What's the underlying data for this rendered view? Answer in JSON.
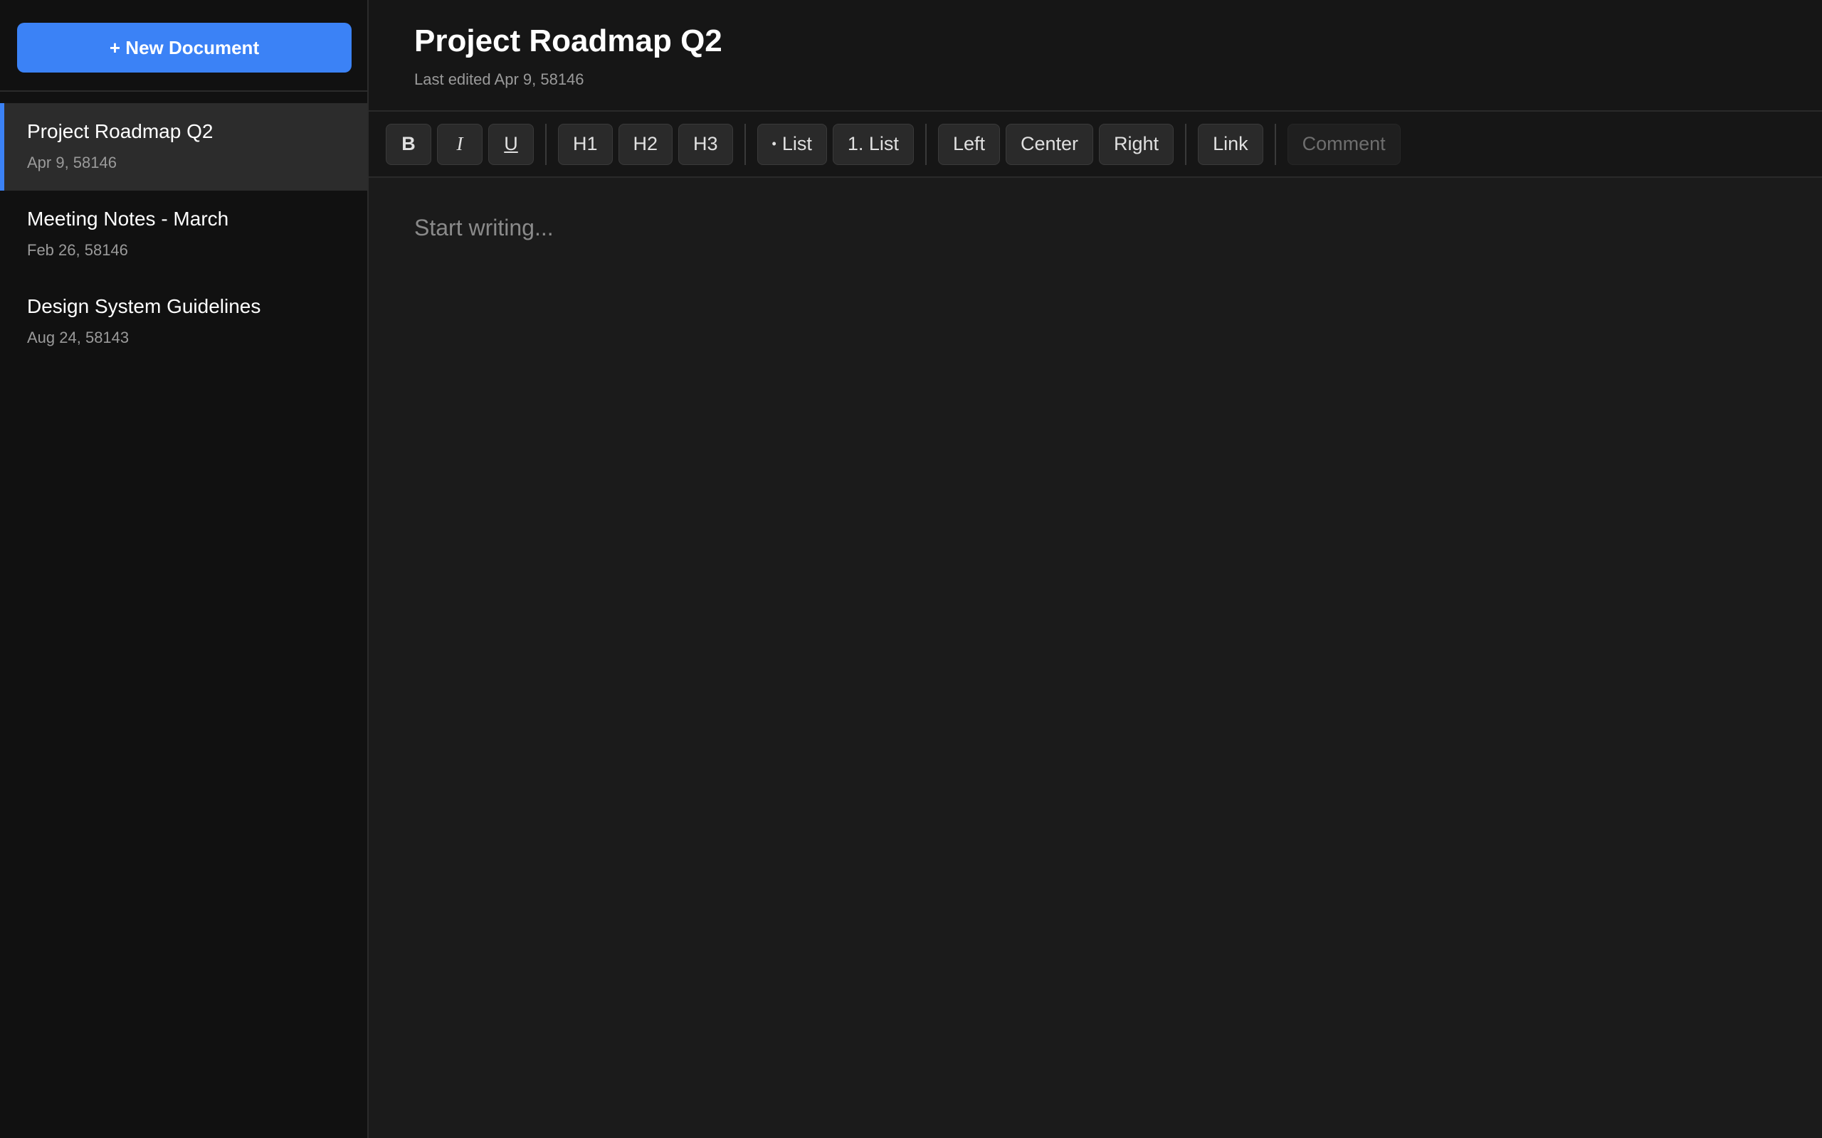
{
  "sidebar": {
    "new_document_label": "+ New Document",
    "documents": [
      {
        "title": "Project Roadmap Q2",
        "date": "Apr 9, 58146",
        "active": true
      },
      {
        "title": "Meeting Notes - March",
        "date": "Feb 26, 58146",
        "active": false
      },
      {
        "title": "Design System Guidelines",
        "date": "Aug 24, 58143",
        "active": false
      }
    ]
  },
  "header": {
    "title": "Project Roadmap Q2",
    "last_edited": "Last edited Apr 9, 58146"
  },
  "toolbar": {
    "bold": "B",
    "italic": "I",
    "underline": "U",
    "h1": "H1",
    "h2": "H2",
    "h3": "H3",
    "bullet_list": "List",
    "numbered_list": "1. List",
    "align_left": "Left",
    "align_center": "Center",
    "align_right": "Right",
    "link": "Link",
    "comment": "Comment",
    "comment_enabled": false
  },
  "editor": {
    "placeholder": "Start writing..."
  },
  "colors": {
    "accent": "#3b82f6",
    "sidebar_bg": "#111111",
    "main_bg": "#1b1b1b"
  },
  "icons": {
    "bullet": "bullet-dot-icon"
  }
}
